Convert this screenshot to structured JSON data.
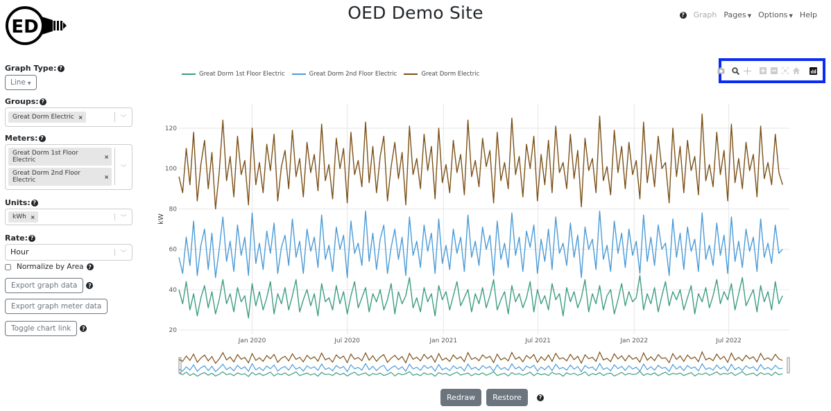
{
  "header": {
    "title": "OED Demo Site",
    "logo_text": "ED",
    "nav": [
      {
        "label": "Graph",
        "disabled": true,
        "has_help_icon": true
      },
      {
        "label": "Pages",
        "caret": true
      },
      {
        "label": "Options",
        "caret": true
      },
      {
        "label": "Help"
      }
    ]
  },
  "sidebar": {
    "graph_type": {
      "label": "Graph Type:",
      "value": "Line"
    },
    "groups": {
      "label": "Groups:",
      "selected": [
        "Great Dorm Electric"
      ]
    },
    "meters": {
      "label": "Meters:",
      "selected": [
        "Great Dorm 1st Floor Electric",
        "Great Dorm 2nd Floor Electric"
      ]
    },
    "units": {
      "label": "Units:",
      "selected": [
        "kWh"
      ]
    },
    "rate": {
      "label": "Rate:",
      "value": "Hour"
    },
    "normalize": {
      "label": "Normalize by Area",
      "checked": false
    },
    "buttons": {
      "export_graph": "Export graph data",
      "export_meter": "Export graph meter data",
      "toggle_link": "Toggle chart link"
    }
  },
  "modebar": [
    "camera-icon",
    "zoom-icon",
    "pan-icon",
    "zoom-in-icon",
    "zoom-out-icon",
    "autoscale-icon",
    "reset-axes-icon",
    "plotly-logo-icon"
  ],
  "controls": {
    "redraw": "Redraw",
    "restore": "Restore"
  },
  "chart_data": {
    "type": "line",
    "title": "",
    "xlabel": "",
    "ylabel": "kW",
    "ylim": [
      18,
      132
    ],
    "xlim": [
      "2019-08-14",
      "2022-10-25"
    ],
    "yticks": [
      20,
      40,
      60,
      80,
      100,
      120
    ],
    "xticks": [
      {
        "date": "2020-01-01",
        "label": "Jan 2020"
      },
      {
        "date": "2020-07-01",
        "label": "Jul 2020"
      },
      {
        "date": "2021-01-01",
        "label": "Jan 2021"
      },
      {
        "date": "2021-07-01",
        "label": "Jul 2021"
      },
      {
        "date": "2022-01-01",
        "label": "Jan 2022"
      },
      {
        "date": "2022-07-01",
        "label": "Jul 2022"
      }
    ],
    "grid": true,
    "legend_position": "top-left",
    "range_slider": true,
    "sampling": "approximate weekly samples read from chart (source is daily/hourly)",
    "x_start": "2019-08-14",
    "x_step_days": 7,
    "series": [
      {
        "name": "Great Dorm 1st Floor Electric",
        "color": "#3d9c80",
        "values": [
          40,
          33,
          44,
          30,
          38,
          27,
          36,
          42,
          31,
          39,
          28,
          35,
          45,
          33,
          38,
          29,
          41,
          34,
          37,
          26,
          43,
          32,
          39,
          30,
          36,
          44,
          28,
          38,
          33,
          41,
          30,
          37,
          45,
          29,
          35,
          40,
          32,
          38,
          27,
          43,
          34,
          36,
          30,
          42,
          33,
          39,
          28,
          37,
          44,
          31,
          36,
          41,
          29,
          38,
          34,
          40,
          30,
          35,
          43,
          28,
          39,
          33,
          37,
          46,
          31,
          36,
          29,
          41,
          34,
          38,
          27,
          42,
          35,
          39,
          30,
          37,
          44,
          32,
          36,
          40,
          29,
          38,
          33,
          41,
          31,
          37,
          45,
          30,
          35,
          39,
          28,
          42,
          34,
          38,
          31,
          36,
          44,
          29,
          40,
          33,
          37,
          30,
          43,
          35,
          38,
          27,
          41,
          34,
          39,
          31,
          36,
          45,
          29,
          38,
          33,
          42,
          30,
          37,
          40,
          28,
          35,
          43,
          32,
          39,
          34,
          36,
          47,
          30,
          38,
          33,
          41,
          29,
          37,
          44,
          32,
          39,
          35,
          40,
          30,
          36,
          42,
          28,
          38,
          34,
          41,
          31,
          37,
          45,
          33,
          39,
          35,
          43,
          30,
          38,
          46,
          32,
          36,
          40,
          29,
          42,
          34,
          39,
          30,
          44,
          33,
          37
        ]
      },
      {
        "name": "Great Dorm 2nd Floor Electric",
        "color": "#4a9ad6",
        "values": [
          56,
          48,
          66,
          52,
          74,
          47,
          62,
          70,
          50,
          68,
          46,
          60,
          76,
          54,
          64,
          49,
          72,
          57,
          66,
          47,
          78,
          53,
          63,
          50,
          69,
          58,
          73,
          48,
          61,
          67,
          52,
          75,
          56,
          64,
          48,
          70,
          59,
          66,
          51,
          77,
          55,
          62,
          49,
          71,
          60,
          67,
          46,
          74,
          58,
          63,
          52,
          79,
          54,
          68,
          50,
          65,
          72,
          48,
          61,
          70,
          55,
          66,
          47,
          76,
          57,
          64,
          51,
          72,
          59,
          68,
          48,
          75,
          53,
          62,
          50,
          70,
          58,
          66,
          49,
          77,
          56,
          64,
          52,
          71,
          60,
          67,
          47,
          74,
          55,
          63,
          51,
          78,
          57,
          66,
          49,
          69,
          61,
          72,
          48,
          65,
          54,
          70,
          50,
          76,
          58,
          63,
          52,
          73,
          56,
          67,
          46,
          71,
          60,
          65,
          50,
          79,
          55,
          62,
          49,
          74,
          58,
          68,
          51,
          70,
          57,
          64,
          48,
          77,
          54,
          66,
          52,
          72,
          60,
          63,
          47,
          75,
          56,
          68,
          50,
          71,
          59,
          65,
          49,
          78,
          55,
          62,
          52,
          73,
          57,
          67,
          48,
          76,
          54,
          64,
          51,
          70,
          59,
          66,
          49,
          75,
          56,
          63,
          53,
          72,
          58,
          60
        ]
      },
      {
        "name": "Great Dorm Electric",
        "color": "#7a4f15",
        "values": [
          96,
          88,
          110,
          92,
          118,
          84,
          102,
          114,
          90,
          108,
          80,
          98,
          124,
          94,
          106,
          86,
          116,
          97,
          104,
          82,
          120,
          92,
          103,
          88,
          112,
          99,
          117,
          84,
          101,
          109,
          90,
          119,
          96,
          105,
          86,
          113,
          98,
          107,
          89,
          122,
          94,
          102,
          85,
          115,
          100,
          110,
          83,
          118,
          97,
          104,
          91,
          123,
          93,
          111,
          88,
          106,
          116,
          84,
          101,
          113,
          95,
          108,
          82,
          121,
          97,
          105,
          90,
          117,
          99,
          111,
          85,
          120,
          93,
          102,
          88,
          114,
          98,
          107,
          87,
          124,
          96,
          104,
          91,
          115,
          101,
          109,
          83,
          118,
          94,
          103,
          90,
          125,
          97,
          106,
          86,
          112,
          100,
          116,
          84,
          107,
          92,
          114,
          88,
          121,
          98,
          103,
          90,
          117,
          95,
          109,
          81,
          115,
          99,
          105,
          88,
          126,
          94,
          101,
          87,
          119,
          98,
          111,
          90,
          113,
          97,
          104,
          85,
          123,
          93,
          107,
          91,
          116,
          100,
          103,
          83,
          120,
          96,
          111,
          88,
          114,
          99,
          106,
          87,
          127,
          94,
          102,
          91,
          118,
          97,
          109,
          84,
          122,
          93,
          105,
          90,
          113,
          99,
          107,
          86,
          121,
          95,
          103,
          92,
          117,
          98,
          92
        ]
      }
    ]
  }
}
